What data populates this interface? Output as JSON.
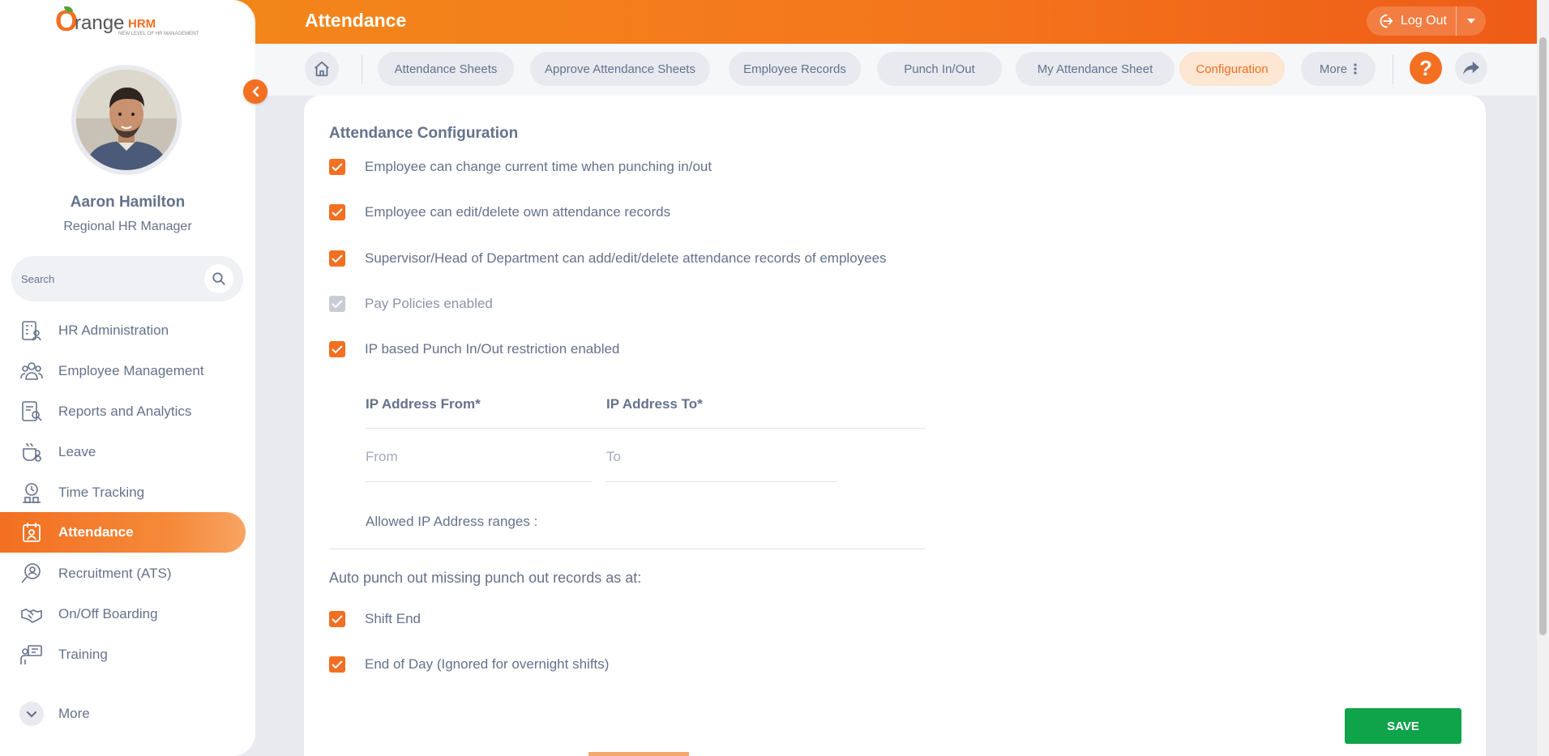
{
  "header": {
    "title": "Attendance",
    "logout_label": "Log Out"
  },
  "subnav": {
    "tabs": [
      {
        "label": "Attendance Sheets",
        "active": false
      },
      {
        "label": "Approve Attendance Sheets",
        "active": false
      },
      {
        "label": "Employee Records",
        "active": false
      },
      {
        "label": "Punch In/Out",
        "active": false
      },
      {
        "label": "My Attendance Sheet",
        "active": false
      },
      {
        "label": "Configuration",
        "active": true
      },
      {
        "label": "More",
        "active": false
      }
    ],
    "help_label": "?"
  },
  "sidebar": {
    "logo": {
      "o": "O",
      "range": "range",
      "hrm": "HRM",
      "tagline": "NEW LEVEL OF HR MANAGEMENT"
    },
    "user": {
      "name": "Aaron Hamilton",
      "role": "Regional HR Manager"
    },
    "search_placeholder": "Search",
    "items": [
      {
        "label": "HR Administration",
        "icon": "hr-admin-icon"
      },
      {
        "label": "Employee Management",
        "icon": "employee-management-icon"
      },
      {
        "label": "Reports and Analytics",
        "icon": "reports-icon"
      },
      {
        "label": "Leave",
        "icon": "leave-icon"
      },
      {
        "label": "Time Tracking",
        "icon": "time-tracking-icon"
      },
      {
        "label": "Attendance",
        "icon": "attendance-icon",
        "active": true
      },
      {
        "label": "Recruitment (ATS)",
        "icon": "recruitment-icon"
      },
      {
        "label": "On/Off Boarding",
        "icon": "onboarding-icon"
      },
      {
        "label": "Training",
        "icon": "training-icon"
      }
    ],
    "more_label": "More"
  },
  "config": {
    "title": "Attendance Configuration",
    "options": [
      {
        "label": "Employee can change current time when punching in/out",
        "checked": true,
        "disabled": false
      },
      {
        "label": "Employee can edit/delete own attendance records",
        "checked": true,
        "disabled": false
      },
      {
        "label": "Supervisor/Head of Department can add/edit/delete attendance records of employees",
        "checked": true,
        "disabled": false
      },
      {
        "label": "Pay Policies enabled",
        "checked": true,
        "disabled": true
      },
      {
        "label": "IP based Punch In/Out restriction enabled",
        "checked": true,
        "disabled": false
      }
    ],
    "ip_from": {
      "label": "IP Address From",
      "required": "*",
      "placeholder": "From",
      "value": ""
    },
    "ip_to": {
      "label": "IP Address To",
      "required": "*",
      "placeholder": "To",
      "value": ""
    },
    "allowed_ranges_label": "Allowed IP Address ranges :",
    "auto_punch_label": "Auto punch out missing punch out records as at:",
    "auto_options": [
      {
        "label": "Shift End",
        "checked": true
      },
      {
        "label": "End of Day (Ignored for overnight shifts)",
        "checked": true
      }
    ],
    "save_label": "SAVE"
  },
  "colors": {
    "accent": "#f36f21",
    "save": "#0fa34a",
    "text": "#64728c"
  }
}
